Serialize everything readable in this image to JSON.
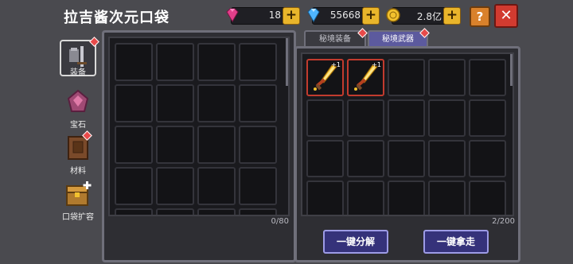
{
  "header": {
    "title": "拉吉酱次元口袋",
    "resources": [
      {
        "name": "pink-gem",
        "value": "18",
        "color": "#e23f8a"
      },
      {
        "name": "blue-gem",
        "value": "55668",
        "color": "#4fb6ff"
      },
      {
        "name": "gold-coin",
        "value": "2.8亿",
        "color": "#f2c12e"
      }
    ],
    "help_label": "?",
    "close_label": "✕"
  },
  "sidebar": {
    "items": [
      {
        "label": "装备",
        "icon": "armor-icon",
        "selected": true,
        "badge": true
      },
      {
        "label": "宝石",
        "icon": "gem-icon",
        "selected": false,
        "badge": false
      },
      {
        "label": "材料",
        "icon": "material-box-icon",
        "selected": false,
        "badge": true
      },
      {
        "label": "口袋扩容",
        "icon": "chest-expand-icon",
        "selected": false,
        "badge": false
      }
    ]
  },
  "left_panel": {
    "count": "0/80"
  },
  "right_panel": {
    "tabs": [
      {
        "label": "秘境装备",
        "active": false
      },
      {
        "label": "秘境武器",
        "active": true
      }
    ],
    "items": [
      {
        "name": "golden-sword",
        "enhance": "+1"
      },
      {
        "name": "golden-sword",
        "enhance": "+1"
      }
    ],
    "count": "2/200",
    "buttons": {
      "decompose": "一键分解",
      "take_all": "一键拿走"
    }
  }
}
